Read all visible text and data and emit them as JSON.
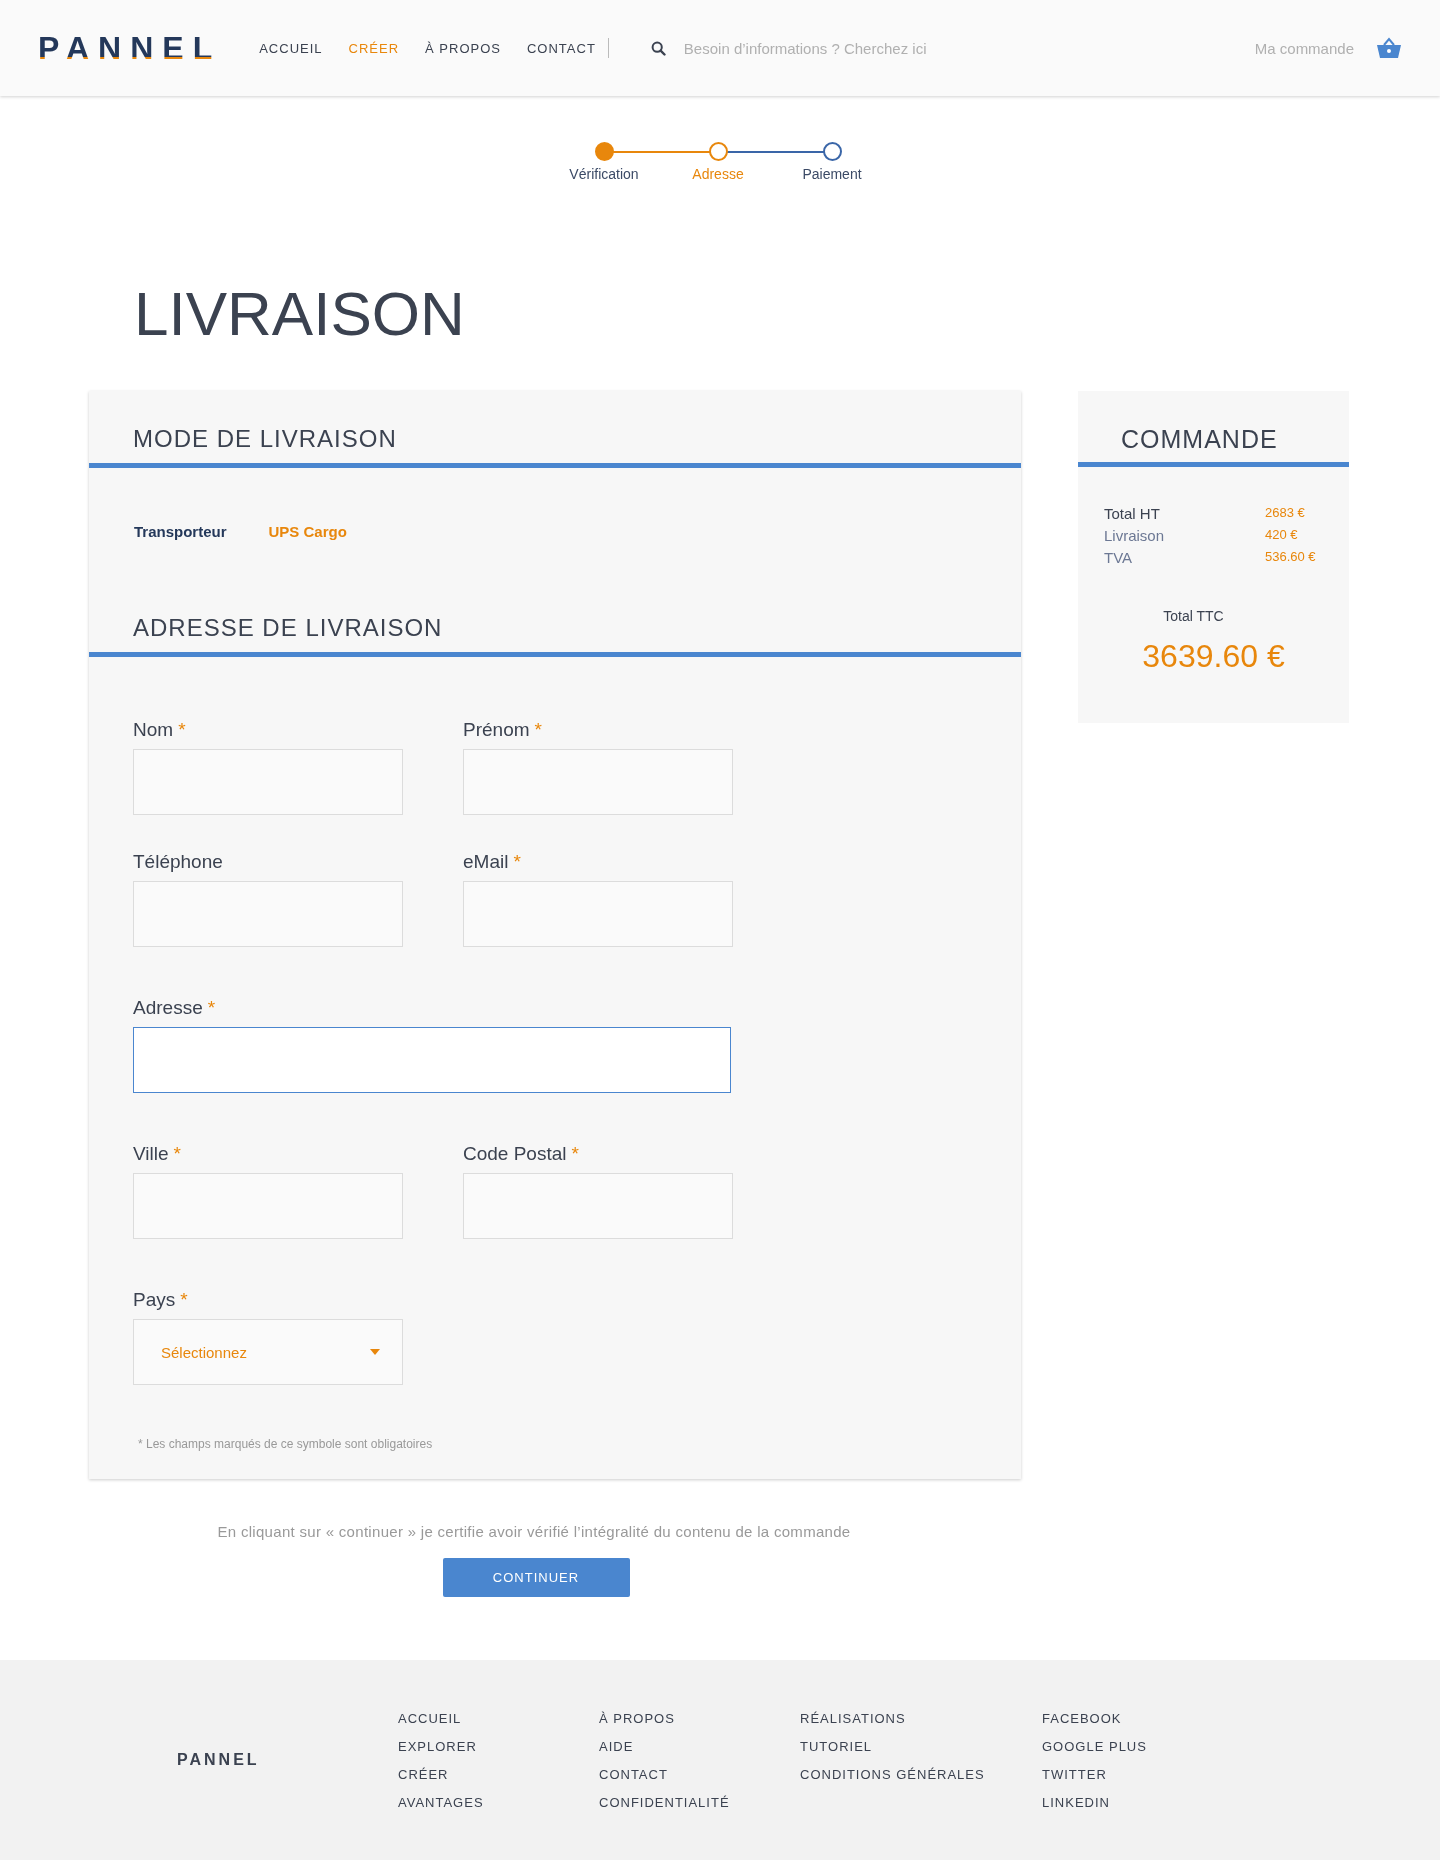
{
  "header": {
    "logo": "PANNEL",
    "nav": [
      {
        "label": "ACCUEIL",
        "selected": false
      },
      {
        "label": "CRÉER",
        "selected": true
      },
      {
        "label": "À PROPOS",
        "selected": false
      },
      {
        "label": "CONTACT",
        "selected": false
      }
    ],
    "search": {
      "placeholder": "Besoin d’informations ? Cherchez ici"
    },
    "cart": {
      "label": "Ma commande"
    }
  },
  "steps": [
    {
      "label": "Vérification",
      "reached": true,
      "current": false
    },
    {
      "label": "Adresse",
      "reached": true,
      "current": true
    },
    {
      "label": "Paiement",
      "reached": false,
      "current": false
    }
  ],
  "title": "LIVRAISON",
  "delivery_mode": {
    "heading": "MODE DE LIVRAISON",
    "label": "Transporteur",
    "value": "UPS Cargo"
  },
  "address": {
    "heading": "ADRESSE DE LIVRAISON",
    "rows": [
      [
        {
          "label": "Nom",
          "required_mark": "*",
          "kind": "text",
          "focused": false
        },
        {
          "label": "Prénom",
          "required_mark": "*",
          "kind": "text",
          "focused": false
        }
      ],
      [
        {
          "label": "Téléphone",
          "kind": "text",
          "focused": false
        },
        {
          "label": "eMail",
          "required_mark": "*",
          "kind": "text",
          "focused": false
        }
      ],
      [
        {
          "label": "Adresse",
          "required_mark": "*",
          "kind": "text",
          "focused": true
        }
      ],
      [
        {
          "label": "Ville",
          "required_mark": "*",
          "kind": "text",
          "focused": false
        },
        {
          "label": "Code Postal",
          "required_mark": "*",
          "kind": "text",
          "focused": false
        }
      ],
      [
        {
          "label": "Pays",
          "required_mark": "*",
          "kind": "select",
          "focused": false,
          "placeholder": "Sélectionnez"
        }
      ]
    ],
    "note": "* Les champs marqués de ce symbole sont obligatoires"
  },
  "summary": {
    "heading": "COMMANDE",
    "lines": [
      {
        "label": "Total HT",
        "value": "2683 €",
        "strong": true
      },
      {
        "label": "Livraison",
        "value": "420 €",
        "strong": false
      },
      {
        "label": "TVA",
        "value": "536.60 €",
        "strong": false
      }
    ],
    "total_label": "Total TTC",
    "total": "3639.60 €"
  },
  "consent": "En cliquant sur « continuer » je certifie avoir vérifié l’intégralité du contenu de la commande",
  "continue_button": "CONTINUER",
  "footer": {
    "logo": "PANNEL",
    "columns": [
      [
        "ACCUEIL",
        "EXPLORER",
        "CRÉER",
        "AVANTAGES"
      ],
      [
        "À PROPOS",
        "AIDE",
        "CONTACT",
        "CONFIDENTIALITÉ"
      ],
      [
        "RÉALISATIONS",
        "TUTORIEL",
        "CONDITIONS GÉNÉRALES"
      ],
      [
        "FACEBOOK",
        "GOOGLE PLUS",
        "TWITTER",
        "LINKEDIN"
      ]
    ]
  }
}
